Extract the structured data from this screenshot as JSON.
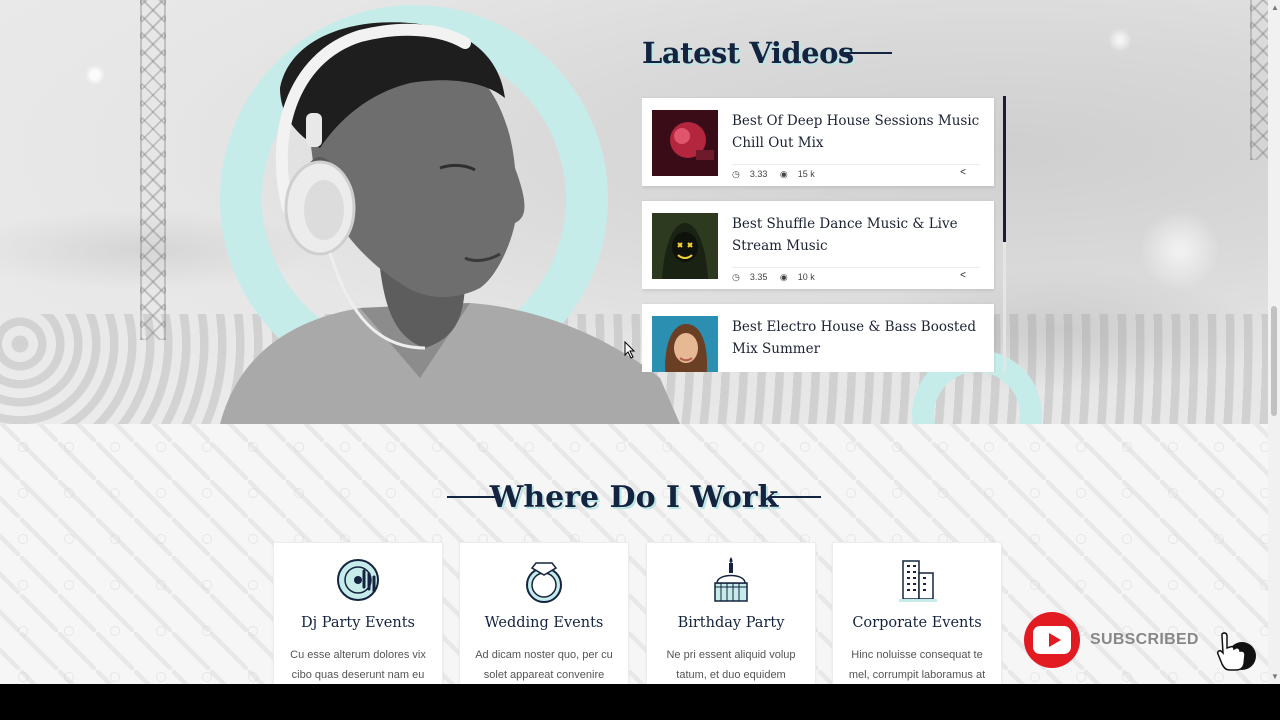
{
  "hero": {
    "videos_title": "Latest Videos",
    "videos": [
      {
        "title": "Best Of Deep House Sessions Music Chill Out Mix",
        "duration": "3.33",
        "views": "15 k"
      },
      {
        "title": "Best Shuffle Dance Music & Live Stream Music",
        "duration": "3.35",
        "views": "10 k"
      },
      {
        "title": "Best Electro House & Bass Boosted Mix Summer",
        "duration": "",
        "views": ""
      }
    ]
  },
  "work": {
    "title": "Where Do I Work",
    "items": [
      {
        "icon": "dj-disc-icon",
        "title": "Dj Party Events",
        "desc": "Cu esse alterum dolores vix cibo quas deserunt nam eu"
      },
      {
        "icon": "ring-icon",
        "title": "Wedding Events",
        "desc": "Ad dicam noster quo, per cu solet appareat convenire"
      },
      {
        "icon": "cake-icon",
        "title": "Birthday Party",
        "desc": "Ne pri essent aliquid volup tatum, et duo equidem"
      },
      {
        "icon": "building-icon",
        "title": "Corporate Events",
        "desc": "Hinc noluisse consequat te mel, corrumpit laboramus at"
      }
    ]
  },
  "badge": {
    "label": "SUBSCRIBED"
  },
  "colors": {
    "accent": "#c6ecea",
    "navy": "#14233f",
    "youtube_red": "#e21b23"
  }
}
